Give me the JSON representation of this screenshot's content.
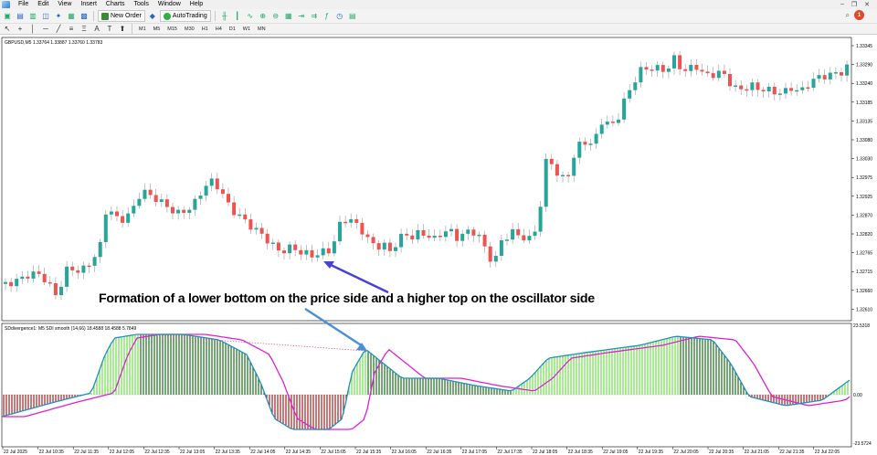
{
  "menu": {
    "items": [
      "File",
      "Edit",
      "View",
      "Insert",
      "Charts",
      "Tools",
      "Window",
      "Help"
    ]
  },
  "toolbar": {
    "new_order_label": "New Order",
    "autotrading_label": "AutoTrading",
    "notification_count": "1",
    "timeframes": [
      "M1",
      "M5",
      "M15",
      "M30",
      "H1",
      "H4",
      "D1",
      "W1",
      "MN"
    ]
  },
  "main_chart": {
    "info_label": "GBPUSD,M5  1.33764 1.33887 1.33760 1.33783",
    "price_labels": [
      "1.33345",
      "1.33290",
      "1.33240",
      "1.33185",
      "1.33135",
      "1.33080",
      "1.33030",
      "1.32975",
      "1.32925",
      "1.32870",
      "1.32820",
      "1.32765",
      "1.32715",
      "1.32660",
      "1.32610"
    ],
    "annotation": "Formation of a lower bottom on the price side and a higher top on the oscillator side",
    "colors": {
      "bull": "#26a69a",
      "bear": "#ef5350",
      "arrow": "#4a3fd8"
    }
  },
  "oscillator": {
    "info_label": "SDdivergence1: M5 SDI smooth (14,66) 18.4588 18.4588 5.7849",
    "axis_top": "23.5318",
    "axis_zero": "0.00",
    "axis_bottom": "-23.5724",
    "colors": {
      "line1": "#e020d0",
      "line2": "#2090c0",
      "hist_up": "#6ee04a",
      "hist_dn": "#a02020"
    }
  },
  "time_labels": [
    "22 Jul 2025",
    "22 Jul 10:35",
    "22 Jul 11:35",
    "22 Jul 12:05",
    "22 Jul 12:35",
    "22 Jul 13:05",
    "22 Jul 13:35",
    "22 Jul 14:05",
    "22 Jul 14:35",
    "22 Jul 15:05",
    "22 Jul 15:35",
    "22 Jul 16:05",
    "22 Jul 16:35",
    "22 Jul 17:05",
    "22 Jul 17:35",
    "22 Jul 18:05",
    "22 Jul 18:35",
    "22 Jul 19:05",
    "22 Jul 19:35",
    "22 Jul 20:05",
    "22 Jul 20:35",
    "22 Jul 21:05",
    "22 Jul 21:35",
    "22 Jul 22:05"
  ]
}
